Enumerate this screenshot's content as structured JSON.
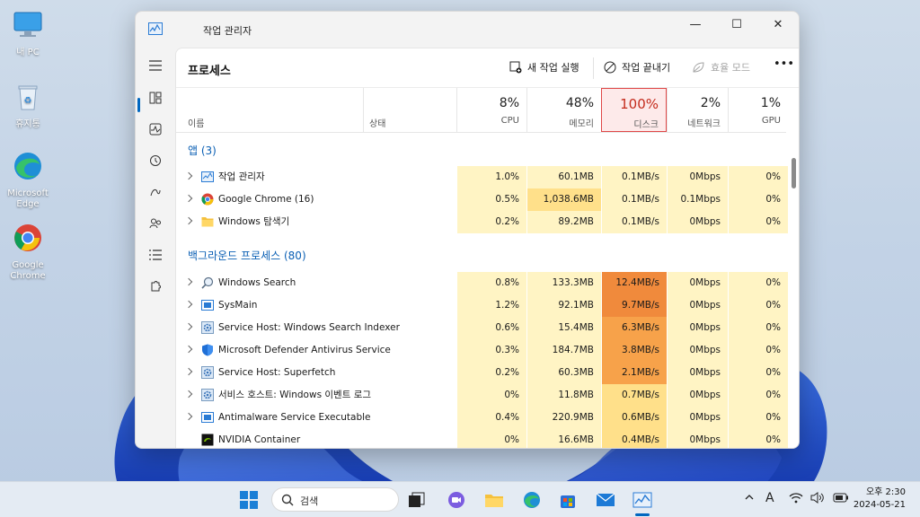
{
  "desktop": {
    "icons": [
      {
        "label": "내 PC"
      },
      {
        "label": "휴지통"
      },
      {
        "label": "Microsoft Edge"
      },
      {
        "label": "Google Chrome"
      }
    ]
  },
  "window": {
    "title": "작업 관리자",
    "caption": {
      "minimize": "—",
      "maximize": "☐",
      "close": "✕"
    }
  },
  "page": {
    "title": "프로세스",
    "toolbar": {
      "new_task": "새 작업 실행",
      "end_task": "작업 끝내기",
      "efficiency": "효율 모드",
      "more": "•••"
    }
  },
  "columns": {
    "name": "이름",
    "status": "상태",
    "cpu": {
      "pct": "8%",
      "label": "CPU"
    },
    "memory": {
      "pct": "48%",
      "label": "메모리"
    },
    "disk": {
      "pct": "100%",
      "label": "디스크"
    },
    "network": {
      "pct": "2%",
      "label": "네트워크"
    },
    "gpu": {
      "pct": "1%",
      "label": "GPU"
    }
  },
  "groups": {
    "apps": "앱 (3)",
    "background": "백그라운드 프로세스 (80)"
  },
  "apps": [
    {
      "name": "작업 관리자",
      "icon": "task-manager-icon",
      "cpu": "1.0%",
      "mem": "60.1MB",
      "disk": "0.1MB/s",
      "net": "0Mbps",
      "gpu": "0%"
    },
    {
      "name": "Google Chrome (16)",
      "icon": "chrome-icon",
      "cpu": "0.5%",
      "mem": "1,038.6MB",
      "disk": "0.1MB/s",
      "net": "0.1Mbps",
      "gpu": "0%"
    },
    {
      "name": "Windows 탐색기",
      "icon": "folder-icon",
      "cpu": "0.2%",
      "mem": "89.2MB",
      "disk": "0.1MB/s",
      "net": "0Mbps",
      "gpu": "0%"
    }
  ],
  "background": [
    {
      "name": "Windows Search",
      "icon": "search-icon",
      "cpu": "0.8%",
      "mem": "133.3MB",
      "disk": "12.4MB/s",
      "net": "0Mbps",
      "gpu": "0%"
    },
    {
      "name": "SysMain",
      "icon": "app-window-icon",
      "cpu": "1.2%",
      "mem": "92.1MB",
      "disk": "9.7MB/s",
      "net": "0Mbps",
      "gpu": "0%"
    },
    {
      "name": "Service Host: Windows Search Indexer",
      "icon": "gear-icon",
      "cpu": "0.6%",
      "mem": "15.4MB",
      "disk": "6.3MB/s",
      "net": "0Mbps",
      "gpu": "0%"
    },
    {
      "name": "Microsoft Defender Antivirus Service",
      "icon": "shield-icon",
      "cpu": "0.3%",
      "mem": "184.7MB",
      "disk": "3.8MB/s",
      "net": "0Mbps",
      "gpu": "0%"
    },
    {
      "name": "Service Host: Superfetch",
      "icon": "gear-icon",
      "cpu": "0.2%",
      "mem": "60.3MB",
      "disk": "2.1MB/s",
      "net": "0Mbps",
      "gpu": "0%"
    },
    {
      "name": "서비스 호스트: Windows 이벤트 로그",
      "icon": "gear-icon",
      "cpu": "0%",
      "mem": "11.8MB",
      "disk": "0.7MB/s",
      "net": "0Mbps",
      "gpu": "0%"
    },
    {
      "name": "Antimalware Service Executable",
      "icon": "app-window-icon",
      "cpu": "0.4%",
      "mem": "220.9MB",
      "disk": "0.6MB/s",
      "net": "0Mbps",
      "gpu": "0%"
    },
    {
      "name": "NVIDIA Container",
      "icon": "nvidia-icon",
      "cpu": "0%",
      "mem": "16.6MB",
      "disk": "0.4MB/s",
      "net": "0Mbps",
      "gpu": "0%"
    }
  ],
  "taskbar": {
    "search_label": "검색",
    "ime": "A",
    "time": "오후 2:30",
    "date": "2024-05-21"
  },
  "colors": {
    "accent": "#0067c0",
    "heat_low": "#fff4c4",
    "heat_mid": "#ffe08a",
    "heat_high": "#f7a24a",
    "heat_max": "#f08a3c",
    "disk_header": "#c42b1c"
  }
}
